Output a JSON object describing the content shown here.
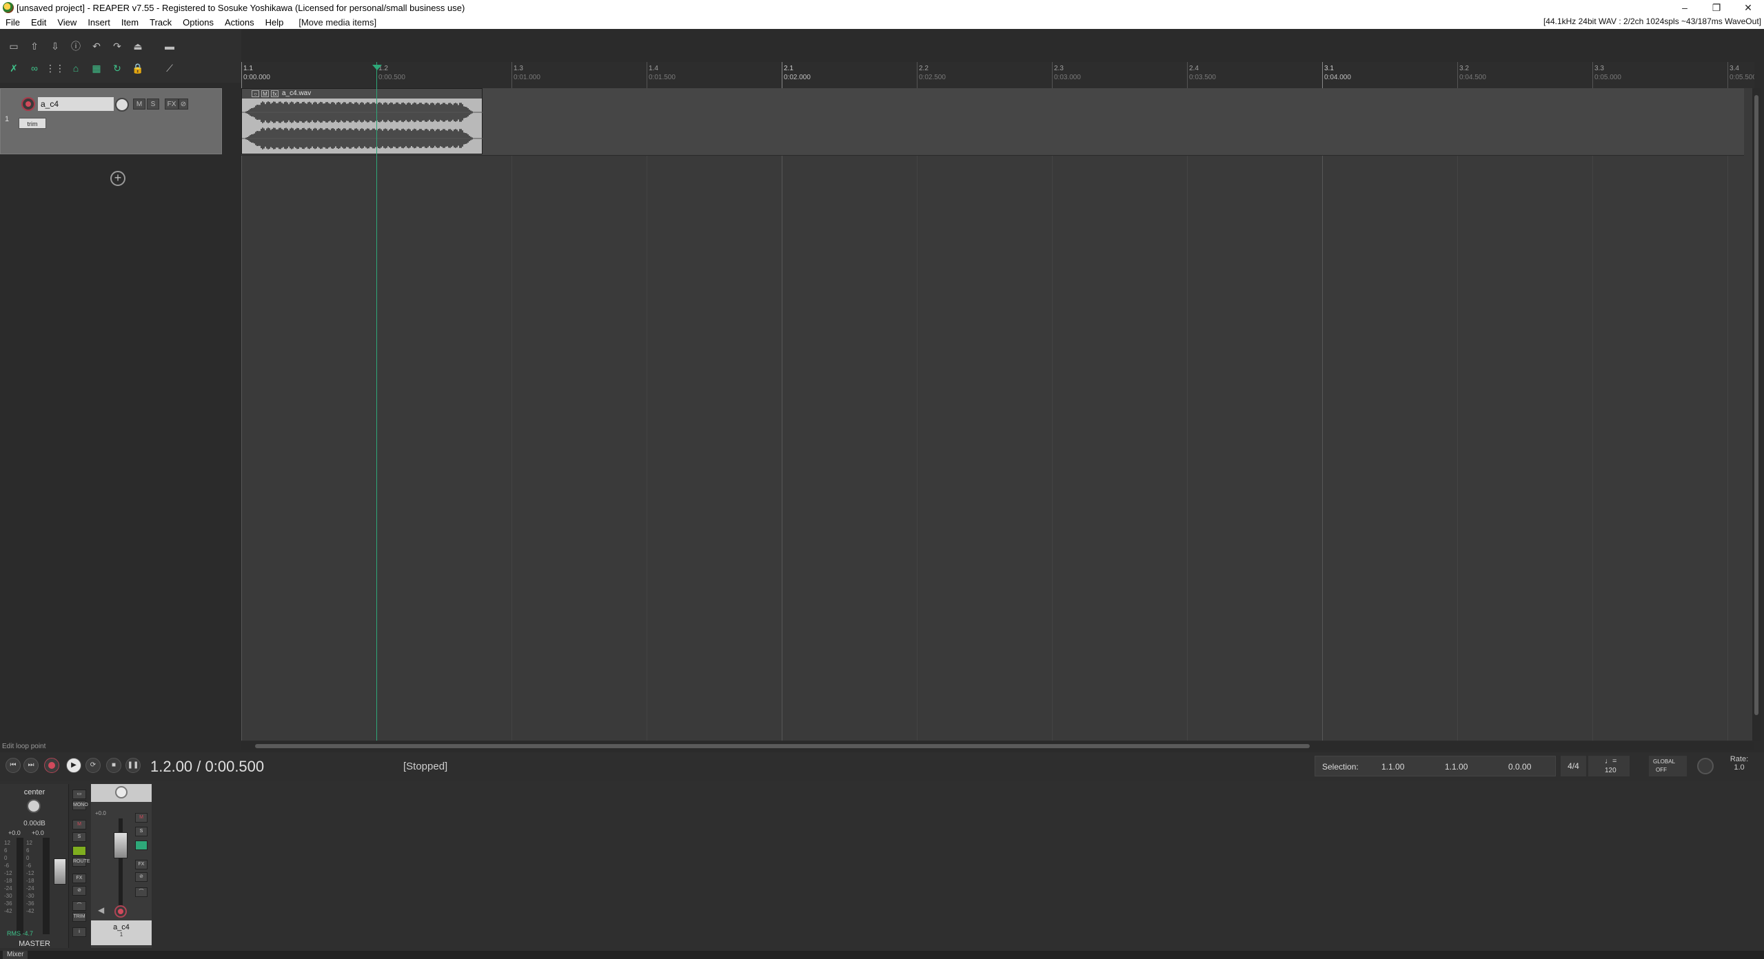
{
  "window": {
    "title": "[unsaved project] - REAPER v7.55 - Registered to Sosuke Yoshikawa (Licensed for personal/small business use)",
    "minimize": "–",
    "restore": "❐",
    "close": "✕"
  },
  "menu": {
    "items": [
      "File",
      "Edit",
      "View",
      "Insert",
      "Item",
      "Track",
      "Options",
      "Actions",
      "Help"
    ],
    "hint": "[Move media items]",
    "audio_status": "[44.1kHz 24bit WAV : 2/2ch 1024spls ~43/187ms WaveOut]"
  },
  "toolbar": {
    "icons": [
      "new-project-icon",
      "open-project-icon",
      "save-project-icon",
      "project-settings-icon",
      "undo-icon",
      "redo-icon",
      "metronome-icon",
      "toggle-icon",
      "ripple-icon",
      "link-icon",
      "grid-icon",
      "snap-icon",
      "grid-lines-icon",
      "loop-icon",
      "lock-icon",
      "envelope-icon"
    ]
  },
  "track": {
    "number": "1",
    "name": "a_c4",
    "mute": "M",
    "solo": "S",
    "fx": "FX",
    "io": "⊘",
    "trim": "trim"
  },
  "ruler": {
    "marks": [
      {
        "meas": "1.1",
        "time": "0:00.000"
      },
      {
        "meas": "1.2",
        "time": "0:00.500"
      },
      {
        "meas": "1.3",
        "time": "0:01.000"
      },
      {
        "meas": "1.4",
        "time": "0:01.500"
      },
      {
        "meas": "2.1",
        "time": "0:02.000"
      },
      {
        "meas": "2.2",
        "time": "0:02.500"
      },
      {
        "meas": "2.3",
        "time": "0:03.000"
      },
      {
        "meas": "2.4",
        "time": "0:03.500"
      },
      {
        "meas": "3.1",
        "time": "0:04.000"
      },
      {
        "meas": "3.2",
        "time": "0:04.500"
      },
      {
        "meas": "3.3",
        "time": "0:05.000"
      },
      {
        "meas": "3.4",
        "time": "0:05.500"
      }
    ]
  },
  "media_item": {
    "name": "a_c4.wav"
  },
  "status_hint": "Edit loop point",
  "transport": {
    "position": "1.2.00 / 0:00.500",
    "state": "[Stopped]",
    "selection_label": "Selection:",
    "sel_start": "1.1.00",
    "sel_end": "1.1.00",
    "sel_length": "0.0.00",
    "time_sig": "4/4",
    "tempo": "120",
    "global_label": "GLOBAL",
    "global_state": "OFF",
    "rate_label": "Rate:",
    "rate_value": "1.0"
  },
  "mixer": {
    "master": {
      "pan": "center",
      "volume": "0.00dB",
      "peak_l": "+0.0",
      "peak_r": "+0.0",
      "rms_label": "RMS",
      "rms_value": "-4.7",
      "name": "MASTER",
      "scale": [
        "12",
        "6",
        "0",
        "-6",
        "-12",
        "-18",
        "-24",
        "-30",
        "-36",
        "-42"
      ],
      "side": [
        "",
        "MONO",
        "M",
        "S",
        "",
        "ROUTE",
        "FX",
        "",
        "",
        "TRIM",
        "i"
      ]
    },
    "track": {
      "volume": "+0.0",
      "name": "a_c4",
      "number": "1",
      "mute": "M",
      "solo": "S",
      "fx": "FX"
    },
    "tab": "Mixer"
  }
}
